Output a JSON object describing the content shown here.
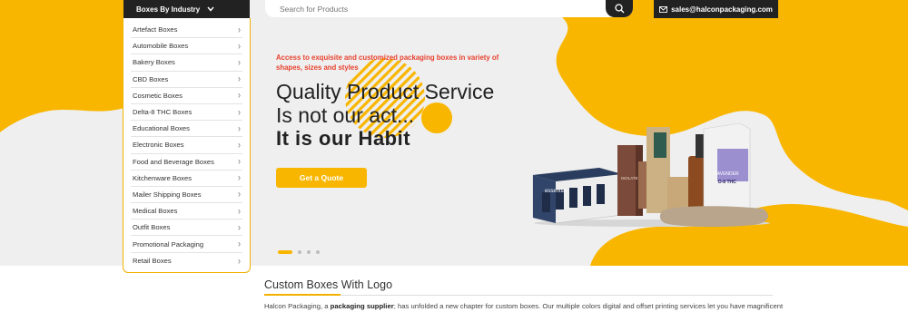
{
  "header": {
    "dept_label": "Boxes By Industry",
    "search_placeholder": "Search for Products",
    "email": "sales@halconpackaging.com"
  },
  "menu": {
    "items": [
      {
        "label": "Artefact Boxes"
      },
      {
        "label": "Automobile Boxes"
      },
      {
        "label": "Bakery Boxes"
      },
      {
        "label": "CBD Boxes"
      },
      {
        "label": "Cosmetic Boxes"
      },
      {
        "label": "Delta-8 THC Boxes"
      },
      {
        "label": "Educational Boxes"
      },
      {
        "label": "Electronic Boxes"
      },
      {
        "label": "Food and Beverage Boxes"
      },
      {
        "label": "Kitchenware Boxes"
      },
      {
        "label": "Mailer Shipping Boxes"
      },
      {
        "label": "Medical Boxes"
      },
      {
        "label": "Outfit Boxes"
      },
      {
        "label": "Promotional Packaging"
      },
      {
        "label": "Retail Boxes"
      }
    ]
  },
  "hero": {
    "tagline": "Access to exquisite and customized packaging boxes in variety of shapes, sizes and styles",
    "headline_line1": "Quality Product Service",
    "headline_line2": "Is not our act...",
    "headline_bold": "It is our Habit",
    "cta_label": "Get a Quote",
    "slides_total": 4,
    "slide_active": 1,
    "product_labels": {
      "essential": "essential",
      "isolate": "ISOLATE",
      "lavender": "LAVENDER",
      "delta": "D-8 THC"
    }
  },
  "section": {
    "title": "Custom Boxes With Logo",
    "text_before": "Halcon Packaging, a ",
    "text_bold": "packaging supplier",
    "text_after": "; has unfolded a new chapter for custom boxes. Our multiple colors digital and offset printing services let you have magnificent"
  },
  "colors": {
    "accent": "#f9b600",
    "dark": "#222222",
    "tagline": "#e8412e",
    "hero_bg": "#efefef"
  },
  "icons": {
    "dropdown": "chevron-down-icon",
    "search": "search-icon",
    "email": "envelope-icon",
    "menu_arrow": "chevron-right-icon"
  }
}
